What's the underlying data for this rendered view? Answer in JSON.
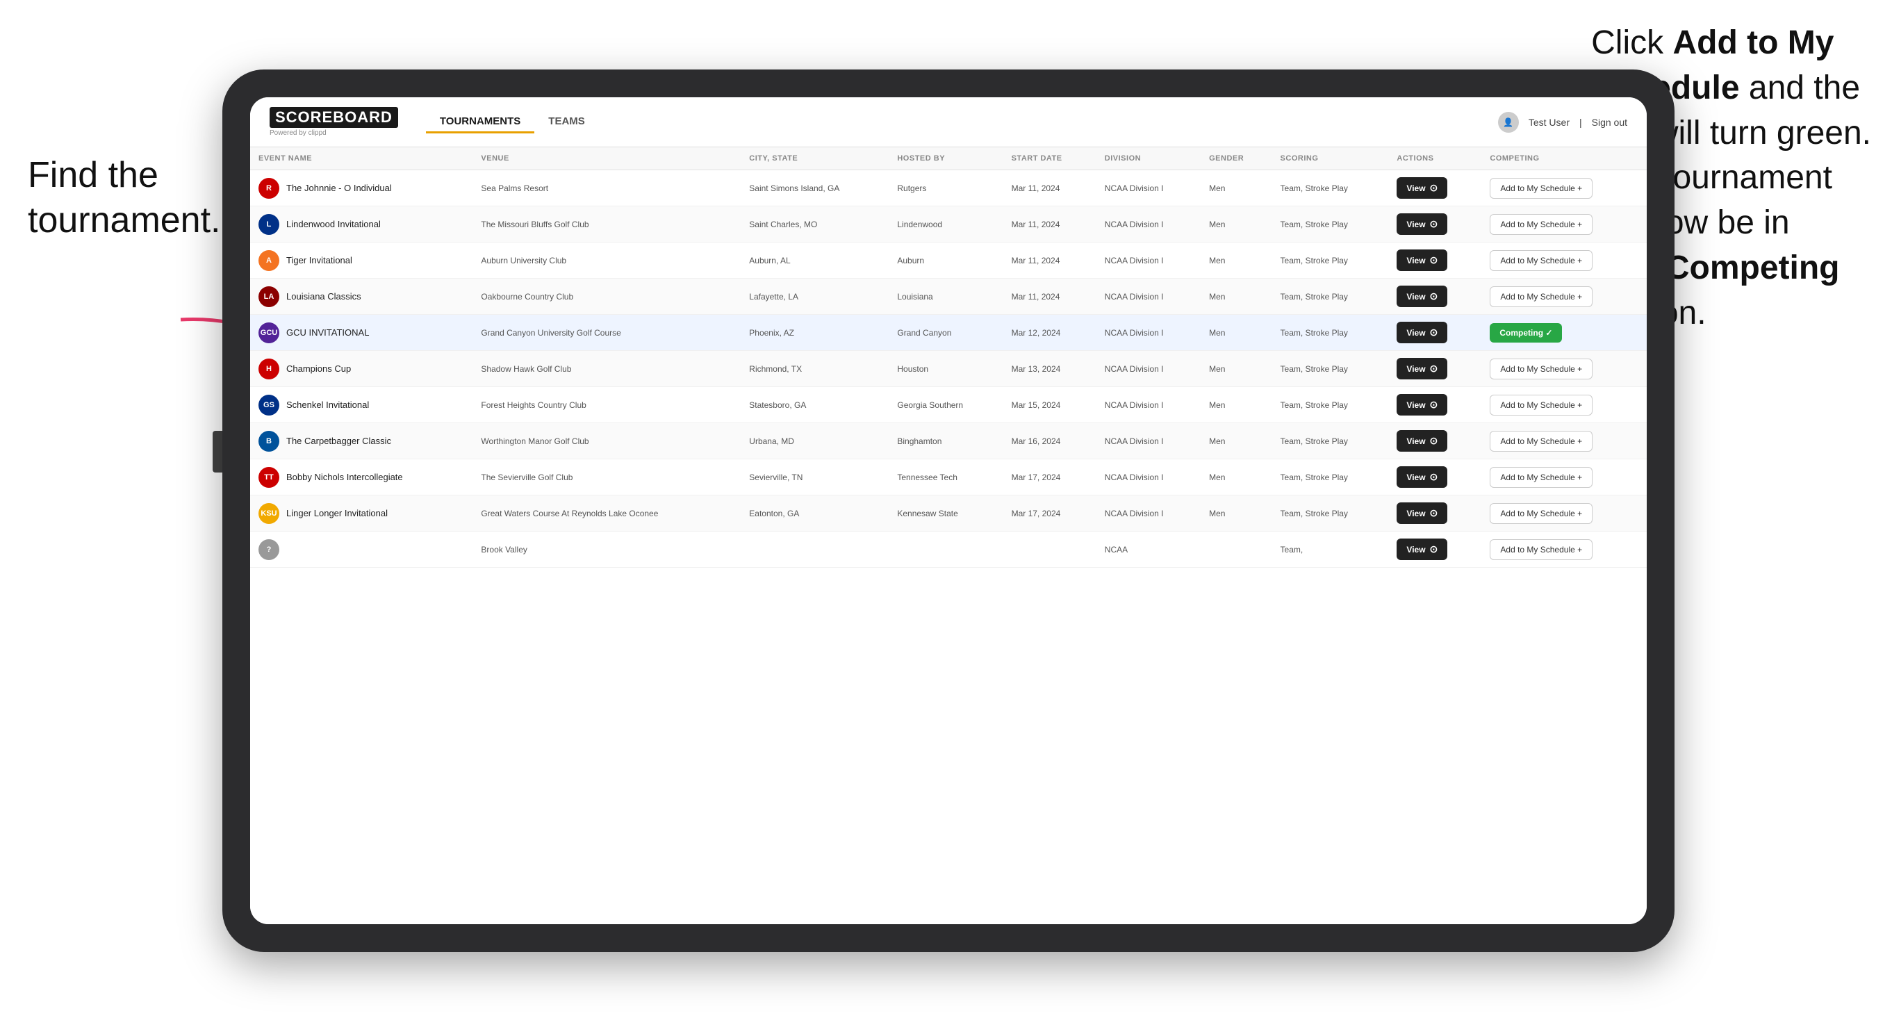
{
  "annotations": {
    "left": "Find the\ntournament.",
    "right_pre": "Click ",
    "right_bold1": "Add to My\nSchedule",
    "right_mid": " and the\nbox will turn green.\nThis tournament\nwill now be in\nyour ",
    "right_bold2": "Competing",
    "right_post": "\nsection."
  },
  "header": {
    "logo": "SCOREBOARD",
    "logo_sub": "Powered by clippd",
    "nav_tabs": [
      "TOURNAMENTS",
      "TEAMS"
    ],
    "active_tab": "TOURNAMENTS",
    "user_label": "Test User",
    "signout_label": "Sign out"
  },
  "table": {
    "columns": [
      "EVENT NAME",
      "VENUE",
      "CITY, STATE",
      "HOSTED BY",
      "START DATE",
      "DIVISION",
      "GENDER",
      "SCORING",
      "ACTIONS",
      "COMPETING"
    ],
    "rows": [
      {
        "logo_text": "R",
        "logo_color": "#cc0000",
        "event_name": "The Johnnie - O Individual",
        "venue": "Sea Palms Resort",
        "city_state": "Saint Simons Island, GA",
        "hosted_by": "Rutgers",
        "start_date": "Mar 11, 2024",
        "division": "NCAA Division I",
        "gender": "Men",
        "scoring": "Team, Stroke Play",
        "action": "View",
        "competing_status": "add",
        "competing_label": "Add to My Schedule +"
      },
      {
        "logo_text": "L",
        "logo_color": "#003087",
        "event_name": "Lindenwood Invitational",
        "venue": "The Missouri Bluffs Golf Club",
        "city_state": "Saint Charles, MO",
        "hosted_by": "Lindenwood",
        "start_date": "Mar 11, 2024",
        "division": "NCAA Division I",
        "gender": "Men",
        "scoring": "Team, Stroke Play",
        "action": "View",
        "competing_status": "add",
        "competing_label": "Add to My Schedule +"
      },
      {
        "logo_text": "A",
        "logo_color": "#f47321",
        "event_name": "Tiger Invitational",
        "venue": "Auburn University Club",
        "city_state": "Auburn, AL",
        "hosted_by": "Auburn",
        "start_date": "Mar 11, 2024",
        "division": "NCAA Division I",
        "gender": "Men",
        "scoring": "Team, Stroke Play",
        "action": "View",
        "competing_status": "add",
        "competing_label": "Add to My Schedule +"
      },
      {
        "logo_text": "LA",
        "logo_color": "#8B0000",
        "event_name": "Louisiana Classics",
        "venue": "Oakbourne Country Club",
        "city_state": "Lafayette, LA",
        "hosted_by": "Louisiana",
        "start_date": "Mar 11, 2024",
        "division": "NCAA Division I",
        "gender": "Men",
        "scoring": "Team, Stroke Play",
        "action": "View",
        "competing_status": "add",
        "competing_label": "Add to My Schedule +"
      },
      {
        "logo_text": "GCU",
        "logo_color": "#522398",
        "event_name": "GCU INVITATIONAL",
        "venue": "Grand Canyon University Golf Course",
        "city_state": "Phoenix, AZ",
        "hosted_by": "Grand Canyon",
        "start_date": "Mar 12, 2024",
        "division": "NCAA Division I",
        "gender": "Men",
        "scoring": "Team, Stroke Play",
        "action": "View",
        "competing_status": "competing",
        "competing_label": "Competing ✓",
        "highlighted": true
      },
      {
        "logo_text": "H",
        "logo_color": "#cc0000",
        "event_name": "Champions Cup",
        "venue": "Shadow Hawk Golf Club",
        "city_state": "Richmond, TX",
        "hosted_by": "Houston",
        "start_date": "Mar 13, 2024",
        "division": "NCAA Division I",
        "gender": "Men",
        "scoring": "Team, Stroke Play",
        "action": "View",
        "competing_status": "add",
        "competing_label": "Add to My Schedule +"
      },
      {
        "logo_text": "GS",
        "logo_color": "#003087",
        "event_name": "Schenkel Invitational",
        "venue": "Forest Heights Country Club",
        "city_state": "Statesboro, GA",
        "hosted_by": "Georgia Southern",
        "start_date": "Mar 15, 2024",
        "division": "NCAA Division I",
        "gender": "Men",
        "scoring": "Team, Stroke Play",
        "action": "View",
        "competing_status": "add",
        "competing_label": "Add to My Schedule +"
      },
      {
        "logo_text": "B",
        "logo_color": "#00529b",
        "event_name": "The Carpetbagger Classic",
        "venue": "Worthington Manor Golf Club",
        "city_state": "Urbana, MD",
        "hosted_by": "Binghamton",
        "start_date": "Mar 16, 2024",
        "division": "NCAA Division I",
        "gender": "Men",
        "scoring": "Team, Stroke Play",
        "action": "View",
        "competing_status": "add",
        "competing_label": "Add to My Schedule +"
      },
      {
        "logo_text": "TT",
        "logo_color": "#cc0000",
        "event_name": "Bobby Nichols Intercollegiate",
        "venue": "The Sevierville Golf Club",
        "city_state": "Sevierville, TN",
        "hosted_by": "Tennessee Tech",
        "start_date": "Mar 17, 2024",
        "division": "NCAA Division I",
        "gender": "Men",
        "scoring": "Team, Stroke Play",
        "action": "View",
        "competing_status": "add",
        "competing_label": "Add to My Schedule +"
      },
      {
        "logo_text": "KSU",
        "logo_color": "#f1a900",
        "event_name": "Linger Longer Invitational",
        "venue": "Great Waters Course At Reynolds Lake Oconee",
        "city_state": "Eatonton, GA",
        "hosted_by": "Kennesaw State",
        "start_date": "Mar 17, 2024",
        "division": "NCAA Division I",
        "gender": "Men",
        "scoring": "Team, Stroke Play",
        "action": "View",
        "competing_status": "add",
        "competing_label": "Add to My Schedule +"
      },
      {
        "logo_text": "?",
        "logo_color": "#999",
        "event_name": "",
        "venue": "Brook Valley",
        "city_state": "",
        "hosted_by": "",
        "start_date": "",
        "division": "NCAA",
        "gender": "",
        "scoring": "Team,",
        "action": "View",
        "competing_status": "add",
        "competing_label": "Add to My Schedule +"
      }
    ]
  }
}
